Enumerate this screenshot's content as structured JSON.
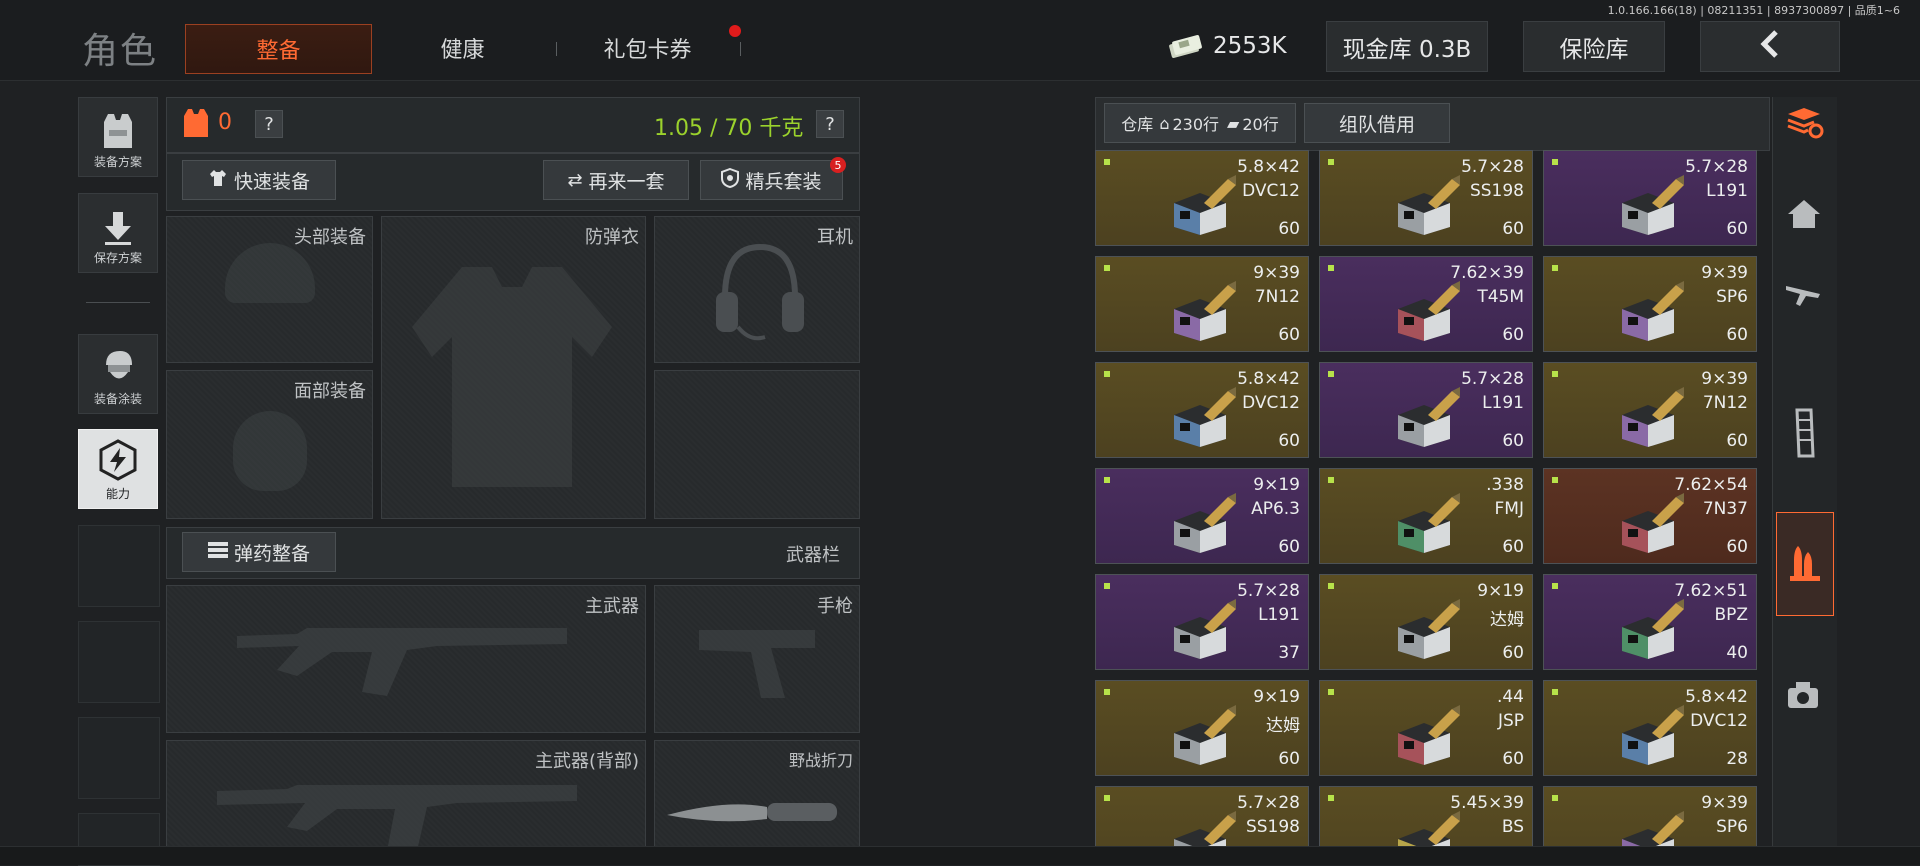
{
  "version_text": "1.0.166.166(18) | 08211351 | 8937300897 | 品质1~6",
  "header": {
    "role_title": "角色",
    "tabs": [
      {
        "label": "整备",
        "active": true
      },
      {
        "label": "健康",
        "active": false
      },
      {
        "label": "礼包卡券",
        "active": false,
        "badge_dot": true
      }
    ],
    "money": "2553K",
    "cash_vault": "现金库 0.3B",
    "insurance": "保险库",
    "back_icon": "chevron-left-icon"
  },
  "left_nav": [
    {
      "label": "装备方案",
      "icon": "vest-icon"
    },
    {
      "label": "保存方案",
      "icon": "download-arrow-icon"
    },
    {
      "label": "装备涂装",
      "icon": "soldier-helmet-icon"
    },
    {
      "label": "能力",
      "icon": "lightning-hex-icon",
      "active": true
    }
  ],
  "loadout": {
    "armor_count": "0",
    "help": "?",
    "weight": "1.05 / 70 千克",
    "quick_equip": "快速装备",
    "again_set": "再来一套",
    "elite_set": "精兵套装",
    "elite_badge": "5",
    "slots": {
      "head": "头部装备",
      "armor": "防弹衣",
      "ear": "耳机",
      "face": "面部装备"
    },
    "ammo_equip": "弹药整备",
    "weapon_bar": "武器栏",
    "primary": "主武器",
    "pistol": "手枪",
    "primary_back": "主武器(背部)",
    "knife": "野战折刀"
  },
  "warehouse": {
    "label": "仓库",
    "rows": "230行",
    "ammo_rows": "20行",
    "team_borrow": "组队借用"
  },
  "colors": {
    "accent_orange": "#ff6a33",
    "weight_green": "#9bd22c",
    "gold_card": "#5a4d22",
    "purple_card": "#4a2e5e",
    "red_card": "#5c3323"
  },
  "items": [
    {
      "caliber": "5.8×42",
      "name": "DVC12",
      "qty": "60",
      "rarity": "gold",
      "box": "blue"
    },
    {
      "caliber": "5.7×28",
      "name": "SS198",
      "qty": "60",
      "rarity": "gold",
      "box": "grey"
    },
    {
      "caliber": "5.7×28",
      "name": "L191",
      "qty": "60",
      "rarity": "purple",
      "box": "grey"
    },
    {
      "caliber": "9×39",
      "name": "7N12",
      "qty": "60",
      "rarity": "gold",
      "box": "purple"
    },
    {
      "caliber": "7.62×39",
      "name": "T45M",
      "qty": "60",
      "rarity": "purple",
      "box": "red"
    },
    {
      "caliber": "9×39",
      "name": "SP6",
      "qty": "60",
      "rarity": "gold",
      "box": "purple"
    },
    {
      "caliber": "5.8×42",
      "name": "DVC12",
      "qty": "60",
      "rarity": "gold",
      "box": "blue"
    },
    {
      "caliber": "5.7×28",
      "name": "L191",
      "qty": "60",
      "rarity": "purple",
      "box": "grey"
    },
    {
      "caliber": "9×39",
      "name": "7N12",
      "qty": "60",
      "rarity": "gold",
      "box": "purple"
    },
    {
      "caliber": "9×19",
      "name": "AP6.3",
      "qty": "60",
      "rarity": "purple",
      "box": "grey"
    },
    {
      "caliber": ".338",
      "name": "FMJ",
      "qty": "60",
      "rarity": "gold",
      "box": "green"
    },
    {
      "caliber": "7.62×54",
      "name": "7N37",
      "qty": "60",
      "rarity": "red",
      "box": "red"
    },
    {
      "caliber": "5.7×28",
      "name": "L191",
      "qty": "37",
      "rarity": "purple",
      "box": "grey"
    },
    {
      "caliber": "9×19",
      "name": "达姆",
      "qty": "60",
      "rarity": "gold",
      "box": "grey"
    },
    {
      "caliber": "7.62×51",
      "name": "BPZ",
      "qty": "40",
      "rarity": "purple",
      "box": "green"
    },
    {
      "caliber": "9×19",
      "name": "达姆",
      "qty": "60",
      "rarity": "gold",
      "box": "grey"
    },
    {
      "caliber": ".44",
      "name": "JSP",
      "qty": "60",
      "rarity": "gold",
      "box": "red"
    },
    {
      "caliber": "5.8×42",
      "name": "DVC12",
      "qty": "28",
      "rarity": "gold",
      "box": "blue"
    },
    {
      "caliber": "5.7×28",
      "name": "SS198",
      "qty": "",
      "rarity": "gold",
      "box": "grey"
    },
    {
      "caliber": "5.45×39",
      "name": "BS",
      "qty": "",
      "rarity": "gold",
      "box": "yellow"
    },
    {
      "caliber": "9×39",
      "name": "SP6",
      "qty": "",
      "rarity": "gold",
      "box": "purple"
    }
  ],
  "right_nav": [
    {
      "icon": "ammo-stack-refresh-icon",
      "active_color": true
    },
    {
      "icon": "home-icon"
    },
    {
      "icon": "rifle-icon"
    },
    {
      "icon": "magazine-icon"
    },
    {
      "icon": "bullets-icon",
      "selected": true
    },
    {
      "icon": "scope-sight-icon"
    }
  ]
}
